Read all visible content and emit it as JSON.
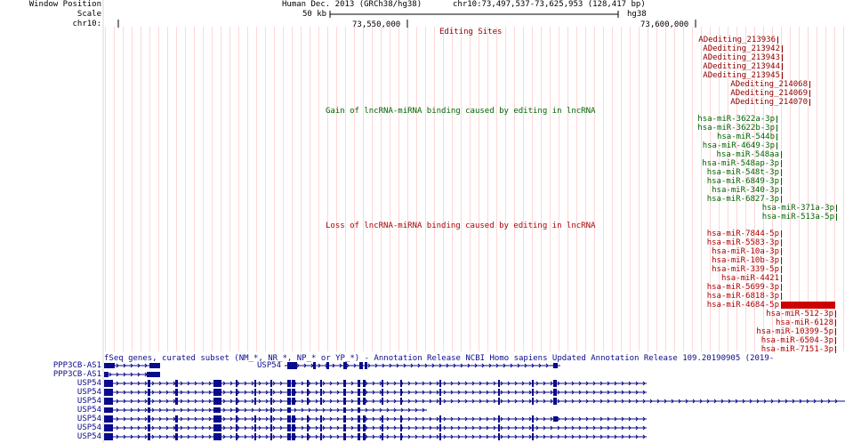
{
  "ruler": {
    "window_position_label": "Window Position",
    "scale_label": "Scale",
    "chrom_label": "chr10:",
    "assembly": "Human Dec. 2013 (GRCh38/hg38)",
    "position": "chr10:73,497,537-73,625,953 (128,417 bp)",
    "scale_text": "50 kb",
    "scale_db": "hg38",
    "tick_1": "73,550,000",
    "tick_2": "73,600,000"
  },
  "editing_track": {
    "title": "Editing Sites",
    "items": [
      "ADediting_213936",
      "ADediting_213942",
      "ADediting_213943",
      "ADediting_213944",
      "ADediting_213945",
      "ADediting_214068",
      "ADediting_214069",
      "ADediting_214070"
    ]
  },
  "gain_track": {
    "title": "Gain of lncRNA-miRNA binding caused by editing in lncRNA",
    "items": [
      "hsa-miR-3622a-3p",
      "hsa-miR-3622b-3p",
      "hsa-miR-544b",
      "hsa-miR-4649-3p",
      "hsa-miR-548aa",
      "hsa-miR-548ap-3p",
      "hsa-miR-548t-3p",
      "hsa-miR-6849-3p",
      "hsa-miR-340-3p",
      "hsa-miR-6827-3p",
      "hsa-miR-371a-3p",
      "hsa-miR-513a-5p"
    ]
  },
  "loss_track": {
    "title": "Loss of lncRNA-miRNA binding caused by editing in lncRNA",
    "items": [
      "hsa-miR-7844-5p",
      "hsa-miR-5583-3p",
      "hsa-miR-10a-3p",
      "hsa-miR-10b-3p",
      "hsa-miR-339-5p",
      "hsa-miR-4421",
      "hsa-miR-5699-3p",
      "hsa-miR-6818-3p",
      "hsa-miR-4684-5p",
      "hsa-miR-512-3p",
      "hsa-miR-6128",
      "hsa-miR-10399-5p",
      "hsa-miR-6504-3p",
      "hsa-miR-7151-3p"
    ]
  },
  "genes_track": {
    "title": "fSeq genes, curated subset (NM_*, NR_*, NP_* or YP_*) - Annotation Release NCBI Homo sapiens Updated Annotation Release 109.20190905 (2019-",
    "inline_label": "USP54",
    "rows": [
      "PPP3CB-AS1",
      "PPP3CB-AS1",
      "USP54",
      "USP54",
      "USP54",
      "USP54",
      "USP54",
      "USP54",
      "USP54"
    ]
  },
  "colors": {
    "editing": "#8b0000",
    "gain": "#006400",
    "loss": "#aa0000",
    "gene": "#0a0a8c",
    "guide": "#ffd6d6"
  }
}
